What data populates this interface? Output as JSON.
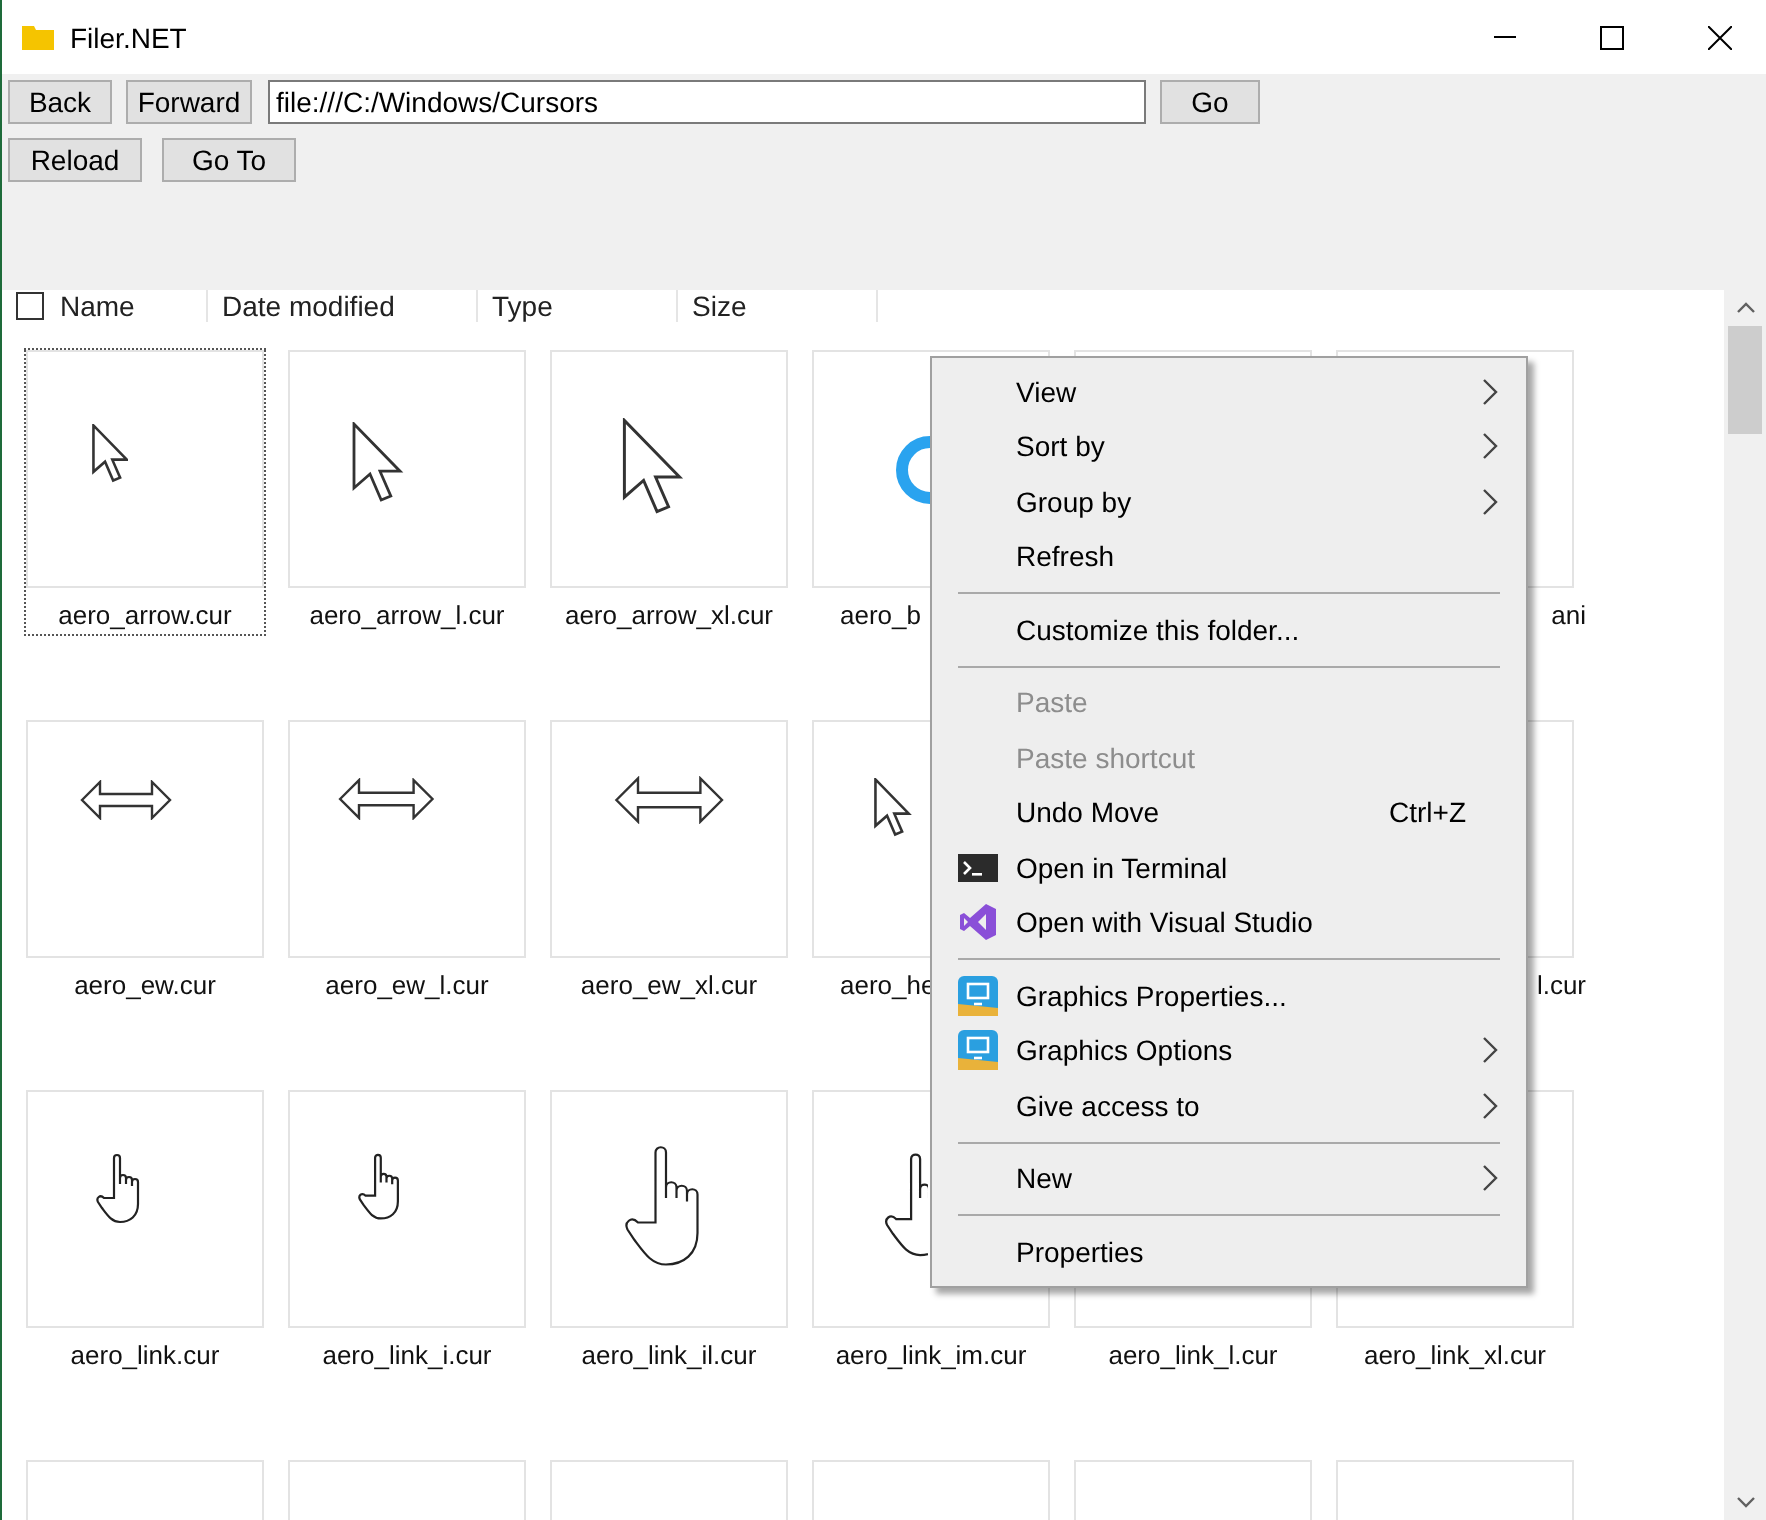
{
  "window": {
    "title": "Filer.NET"
  },
  "toolbar": {
    "buttons_row_1": [
      "Back",
      "Forward"
    ],
    "address": "file:///C:/Windows/Cursors",
    "go_button": "Go",
    "buttons_row_2": [
      "Reload",
      "Go To"
    ]
  },
  "list_header": {
    "checked": false,
    "columns": [
      "Name",
      "Date modified",
      "Type",
      "Size"
    ]
  },
  "tiles": [
    {
      "kind": "arrow",
      "label": "aero_arrow.cur",
      "selected": true
    },
    {
      "kind": "arrow_l",
      "label": "aero_arrow_l.cur",
      "selected": false
    },
    {
      "kind": "arrow_xl",
      "label": "aero_arrow_xl.cur",
      "selected": false
    },
    {
      "kind": "ring",
      "caption": {
        "kind": "head",
        "text": "aero_b"
      },
      "selected": false
    },
    {
      "kind": "blank"
    },
    {
      "kind": "blank",
      "caption": {
        "kind": "tail",
        "text": "ani"
      },
      "selected": false
    },
    {
      "kind": "ew",
      "label": "aero_ew.cur",
      "selected": false
    },
    {
      "kind": "ew_l",
      "label": "aero_ew_l.cur",
      "selected": false
    },
    {
      "kind": "ew_xl",
      "label": "aero_ew_xl.cur",
      "selected": false
    },
    {
      "kind": "help",
      "caption": {
        "kind": "head",
        "text": "aero_he"
      },
      "selected": false
    },
    {
      "kind": "blank"
    },
    {
      "kind": "blank",
      "caption": {
        "kind": "tail",
        "text": "l.cur"
      },
      "selected": false
    },
    {
      "kind": "link",
      "label": "aero_link.cur",
      "selected": false
    },
    {
      "kind": "link_i",
      "label": "aero_link_i.cur",
      "selected": false
    },
    {
      "kind": "link_il",
      "label": "aero_link_il.cur",
      "selected": false
    },
    {
      "kind": "link_im",
      "label": "aero_link_im.cur",
      "selected": false
    },
    {
      "kind": "blank",
      "label": "aero_link_l.cur",
      "selected": false
    },
    {
      "kind": "blank",
      "label": "aero_link_xl.cur",
      "selected": false
    },
    {
      "kind": "blank",
      "selected": false
    },
    {
      "kind": "blank",
      "selected": false
    },
    {
      "kind": "blank",
      "selected": false
    },
    {
      "kind": "blank",
      "selected": false
    },
    {
      "kind": "blank",
      "selected": false
    },
    {
      "kind": "blank",
      "selected": false
    }
  ],
  "context_menu": [
    {
      "kind": "item",
      "label": "View",
      "submenu": true,
      "disabled": false
    },
    {
      "kind": "item",
      "label": "Sort by",
      "submenu": true,
      "disabled": false
    },
    {
      "kind": "item",
      "label": "Group by",
      "submenu": true,
      "disabled": false
    },
    {
      "kind": "item",
      "label": "Refresh",
      "submenu": false,
      "disabled": false
    },
    {
      "kind": "separator"
    },
    {
      "kind": "item",
      "label": "Customize this folder...",
      "submenu": false,
      "disabled": false
    },
    {
      "kind": "separator"
    },
    {
      "kind": "item",
      "label": "Paste",
      "submenu": false,
      "disabled": true
    },
    {
      "kind": "item",
      "label": "Paste shortcut",
      "submenu": false,
      "disabled": true
    },
    {
      "kind": "item",
      "label": "Undo Move",
      "shortcut": "Ctrl+Z",
      "submenu": false,
      "disabled": false
    },
    {
      "kind": "terminal",
      "label": "Open in Terminal",
      "submenu": false,
      "disabled": false
    },
    {
      "kind": "studio",
      "label": "Open with Visual Studio",
      "submenu": false,
      "disabled": false
    },
    {
      "kind": "separator"
    },
    {
      "kind": "graphics",
      "label": "Graphics Properties...",
      "submenu": false,
      "disabled": false
    },
    {
      "kind": "graphics",
      "label": "Graphics Options",
      "submenu": true,
      "disabled": false
    },
    {
      "kind": "item",
      "label": "Give access to",
      "submenu": true,
      "disabled": false
    },
    {
      "kind": "separator"
    },
    {
      "kind": "item",
      "label": "New",
      "submenu": true,
      "disabled": false
    },
    {
      "kind": "separator"
    },
    {
      "kind": "item",
      "label": "Properties",
      "submenu": false,
      "disabled": false
    }
  ]
}
